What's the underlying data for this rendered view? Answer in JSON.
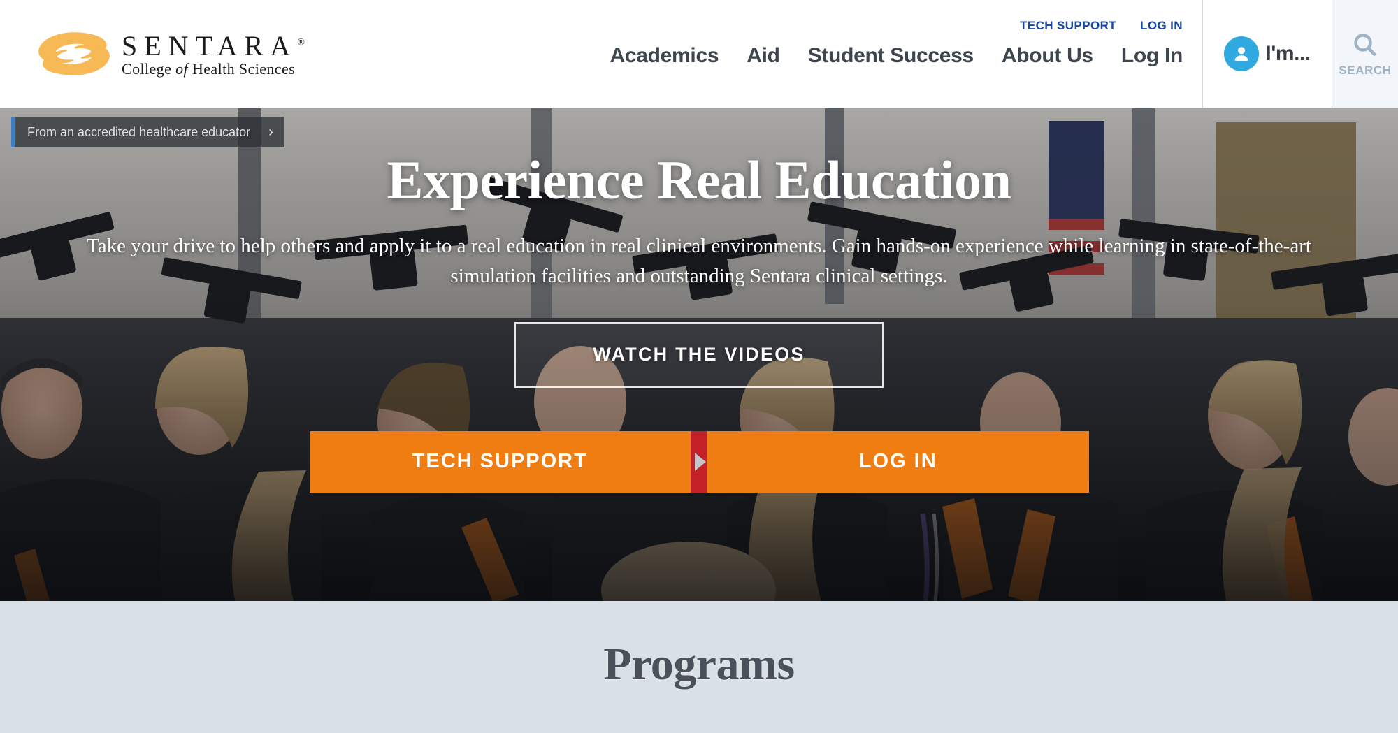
{
  "brand": {
    "name": "SENTARA",
    "registered_mark": "®",
    "tagline_pre": "College ",
    "tagline_italic": "of",
    "tagline_post": " Health Sciences",
    "logo_color": "#f7b955",
    "rule_color": "#e3a53c"
  },
  "header": {
    "utility_links": [
      {
        "label": "TECH SUPPORT"
      },
      {
        "label": "LOG IN"
      }
    ],
    "utility_link_color": "#17479e",
    "nav_items": [
      {
        "label": "Academics"
      },
      {
        "label": "Aid"
      },
      {
        "label": "Student Success"
      },
      {
        "label": "About Us"
      },
      {
        "label": "Log In"
      }
    ],
    "nav_color": "#3e454e",
    "im_menu": {
      "label": "I'm...",
      "avatar_icon": "user-avatar-icon",
      "avatar_color": "#30a8e0"
    },
    "search": {
      "label": "SEARCH",
      "icon": "search-icon",
      "panel_color": "#f2f6fa",
      "icon_color": "#9fb3c6"
    }
  },
  "hero": {
    "badge": {
      "text": "From an accredited healthcare educator",
      "chevron_icon": "chevron-right-icon",
      "accent_color": "#3c7fc4"
    },
    "title": "Experience Real Education",
    "subtitle": "Take your drive to help others and apply it to a real education in real clinical environments. Gain hands-on experience while learning in state-of-the-art simulation facilities and outstanding Sentara clinical settings.",
    "video_button": {
      "label": "WATCH THE VIDEOS"
    },
    "cta_buttons": [
      {
        "label": "TECH SUPPORT"
      },
      {
        "label": "LOG IN"
      }
    ],
    "cta_color": "#f07d12",
    "cta_divider_color": "#c32027",
    "divider_arrow_icon": "play-arrow-icon"
  },
  "programs": {
    "title": "Programs",
    "background_color": "#d9e0e6",
    "title_color": "#4a515a"
  }
}
